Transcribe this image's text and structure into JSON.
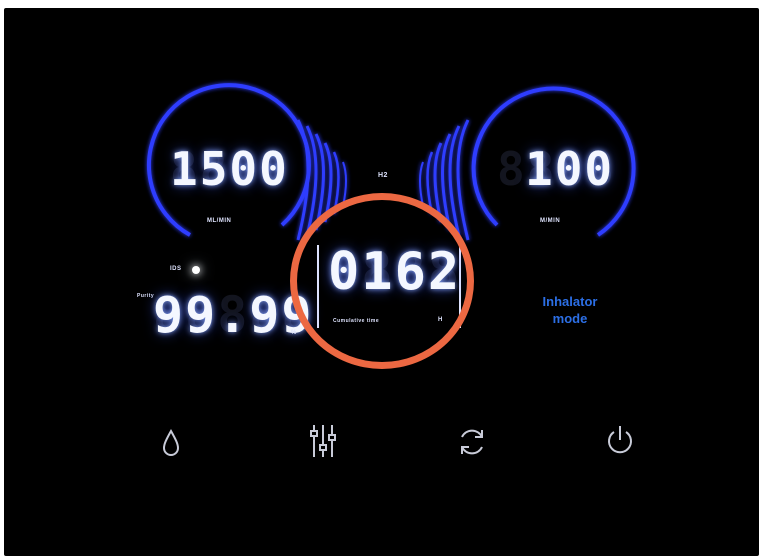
{
  "colors": {
    "panel": "#000000",
    "glow": "#2f3cff",
    "accent_ring": "#ec6842",
    "mode_text": "#2c6fe6"
  },
  "left_dial": {
    "value": "1500",
    "unit": "ML/MIN"
  },
  "right_dial": {
    "value": "100",
    "unit": "M/MIN"
  },
  "center_label": "H2",
  "purity": {
    "label": "Purity",
    "value": "99.99",
    "unit": "%",
    "indicator_label": "IDS"
  },
  "timer": {
    "value": "0162",
    "label": "Cumulative time",
    "unit": "H"
  },
  "mode": {
    "line1": "Inhalator",
    "line2": "mode"
  },
  "buttons": [
    {
      "name": "water-drop-icon"
    },
    {
      "name": "sliders-icon"
    },
    {
      "name": "refresh-icon"
    },
    {
      "name": "power-icon"
    }
  ]
}
